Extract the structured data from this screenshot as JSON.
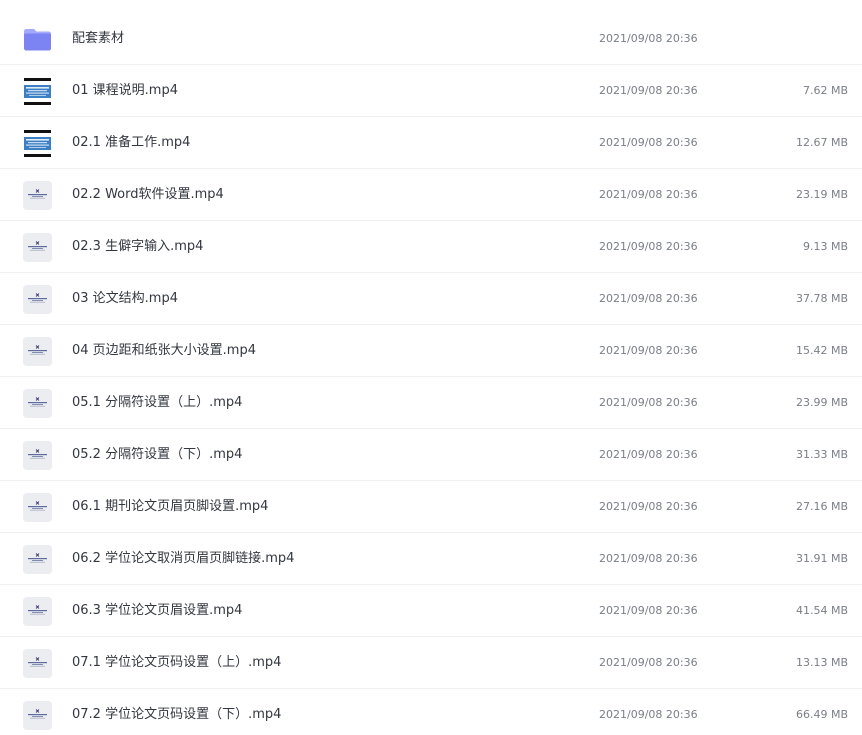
{
  "files": [
    {
      "name": "配套素材",
      "date": "2021/09/08 20:36",
      "size": "",
      "icon": "folder-icon"
    },
    {
      "name": "01 课程说明.mp4",
      "date": "2021/09/08 20:36",
      "size": "7.62 MB",
      "icon": "video-thumbnail-dark-icon"
    },
    {
      "name": "02.1 准备工作.mp4",
      "date": "2021/09/08 20:36",
      "size": "12.67 MB",
      "icon": "video-thumbnail-dark-icon"
    },
    {
      "name": "02.2 Word软件设置.mp4",
      "date": "2021/09/08 20:36",
      "size": "23.19 MB",
      "icon": "video-thumbnail-light-icon"
    },
    {
      "name": "02.3 生僻字输入.mp4",
      "date": "2021/09/08 20:36",
      "size": "9.13 MB",
      "icon": "video-thumbnail-light-icon"
    },
    {
      "name": "03 论文结构.mp4",
      "date": "2021/09/08 20:36",
      "size": "37.78 MB",
      "icon": "video-thumbnail-light-icon"
    },
    {
      "name": "04 页边距和纸张大小设置.mp4",
      "date": "2021/09/08 20:36",
      "size": "15.42 MB",
      "icon": "video-thumbnail-light-icon"
    },
    {
      "name": "05.1 分隔符设置（上）.mp4",
      "date": "2021/09/08 20:36",
      "size": "23.99 MB",
      "icon": "video-thumbnail-light-icon"
    },
    {
      "name": "05.2 分隔符设置（下）.mp4",
      "date": "2021/09/08 20:36",
      "size": "31.33 MB",
      "icon": "video-thumbnail-light-icon"
    },
    {
      "name": "06.1 期刊论文页眉页脚设置.mp4",
      "date": "2021/09/08 20:36",
      "size": "27.16 MB",
      "icon": "video-thumbnail-light-icon"
    },
    {
      "name": "06.2 学位论文取消页眉页脚链接.mp4",
      "date": "2021/09/08 20:36",
      "size": "31.91 MB",
      "icon": "video-thumbnail-light-icon"
    },
    {
      "name": "06.3 学位论文页眉设置.mp4",
      "date": "2021/09/08 20:36",
      "size": "41.54 MB",
      "icon": "video-thumbnail-light-icon"
    },
    {
      "name": "07.1 学位论文页码设置（上）.mp4",
      "date": "2021/09/08 20:36",
      "size": "13.13 MB",
      "icon": "video-thumbnail-light-icon"
    },
    {
      "name": "07.2 学位论文页码设置（下）.mp4",
      "date": "2021/09/08 20:36",
      "size": "66.49 MB",
      "icon": "video-thumbnail-light-icon"
    }
  ],
  "colors": {
    "folder": "#7c83f2",
    "folder_light": "#a3a9ff",
    "thumb_light_bg": "#ecedf1",
    "thumb_dark_band": "#3b7fc4",
    "divider": "#f0f0f2"
  }
}
